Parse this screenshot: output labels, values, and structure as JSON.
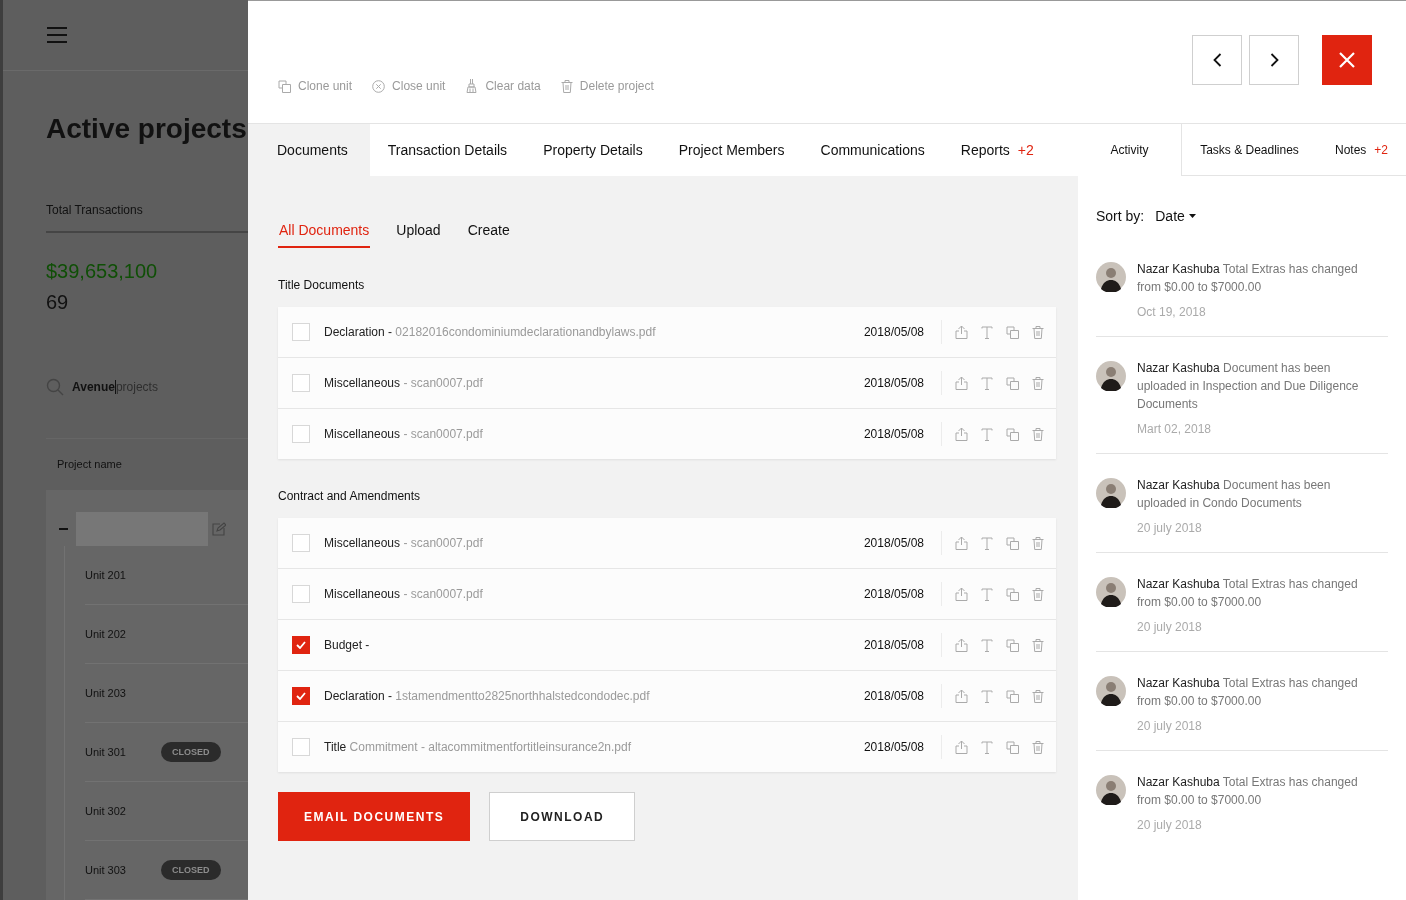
{
  "background": {
    "title": "Active projects",
    "stat_label": "Total Transactions",
    "total": "$39,653,100",
    "count": "69",
    "search": {
      "value": "Avenue",
      "placeholder": "projects"
    },
    "column": "Project name",
    "units": [
      {
        "name": "Unit 201",
        "closed": false
      },
      {
        "name": "Unit 202",
        "closed": false
      },
      {
        "name": "Unit 203",
        "closed": false
      },
      {
        "name": "Unit 301",
        "closed": true,
        "badge": "CLOSED"
      },
      {
        "name": "Unit 302",
        "closed": false
      },
      {
        "name": "Unit 303",
        "closed": true,
        "badge": "CLOSED"
      }
    ]
  },
  "actions": [
    {
      "label": "Clone unit"
    },
    {
      "label": "Close unit"
    },
    {
      "label": "Clear data"
    },
    {
      "label": "Delete project"
    }
  ],
  "tabs": [
    {
      "label": "Documents",
      "selected": true
    },
    {
      "label": "Transaction Details",
      "selected": false
    },
    {
      "label": "Property Details",
      "selected": false
    },
    {
      "label": "Project Members",
      "selected": false
    },
    {
      "label": "Communications",
      "selected": false
    },
    {
      "label": "Reports",
      "badge": "+2",
      "selected": false
    }
  ],
  "side_tabs": [
    {
      "label": "Activity",
      "selected": true
    },
    {
      "label": "Tasks & Deadlines",
      "selected": false
    },
    {
      "label": "Notes",
      "badge": "+2",
      "selected": false
    }
  ],
  "subtabs": [
    {
      "label": "All Documents",
      "selected": true
    },
    {
      "label": "Upload",
      "selected": false
    },
    {
      "label": "Create",
      "selected": false
    }
  ],
  "sections": [
    {
      "title": "Title Documents",
      "rows": [
        {
          "name": "**Declaration -** 02182016condominiumdeclarationandbylaws.pdf",
          "date": "2018/05/08",
          "checked": false
        },
        {
          "name": "**Miscellaneous** - scan0007.pdf",
          "date": "2018/05/08",
          "checked": false
        },
        {
          "name": "**Miscellaneous** - scan0007.pdf",
          "date": "2018/05/08",
          "checked": false
        }
      ]
    },
    {
      "title": "Contract and Amendments",
      "rows": [
        {
          "name": "**Miscellaneous** - scan0007.pdf",
          "date": "2018/05/08",
          "checked": false
        },
        {
          "name": "**Miscellaneous** - scan0007.pdf",
          "date": "2018/05/08",
          "checked": false
        },
        {
          "name": "**Budget -**",
          "date": "2018/05/08",
          "checked": true
        },
        {
          "name": "**Declaration -** 1stamendmentto2825northhalstedcondodec.pdf",
          "date": "2018/05/08",
          "checked": true
        },
        {
          "name": "**Title** Commitment - altacommitmentfortitleinsurance2n.pdf",
          "date": "2018/05/08",
          "checked": false
        }
      ]
    }
  ],
  "buttons": [
    {
      "label": "EMAIL DOCUMENTS",
      "kind": "primary"
    },
    {
      "label": "DOWNLOAD",
      "kind": "secondary"
    }
  ],
  "activity": {
    "sort_label": "Sort by:",
    "sort_value": "Date",
    "items": [
      {
        "text": "**Nazar Kashuba** Total Extras has changed from $0.00 to $7000.00",
        "date": "Oct 19, 2018"
      },
      {
        "text": "**Nazar Kashuba** Document has been uploaded in Inspection and Due Diligence Documents",
        "date": "Mart 02, 2018"
      },
      {
        "text": "**Nazar Kashuba** Document has been uploaded in Condo Documents",
        "date": "20 july 2018"
      },
      {
        "text": "**Nazar Kashuba** Total Extras has changed from $0.00 to $7000.00",
        "date": "20 july 2018"
      },
      {
        "text": "**Nazar Kashuba** Total Extras has changed from $0.00 to $7000.00",
        "date": "20 july 2018"
      },
      {
        "text": "**Nazar Kashuba** Total Extras has changed from $0.00 to $7000.00",
        "date": "20 july 2018"
      }
    ]
  }
}
